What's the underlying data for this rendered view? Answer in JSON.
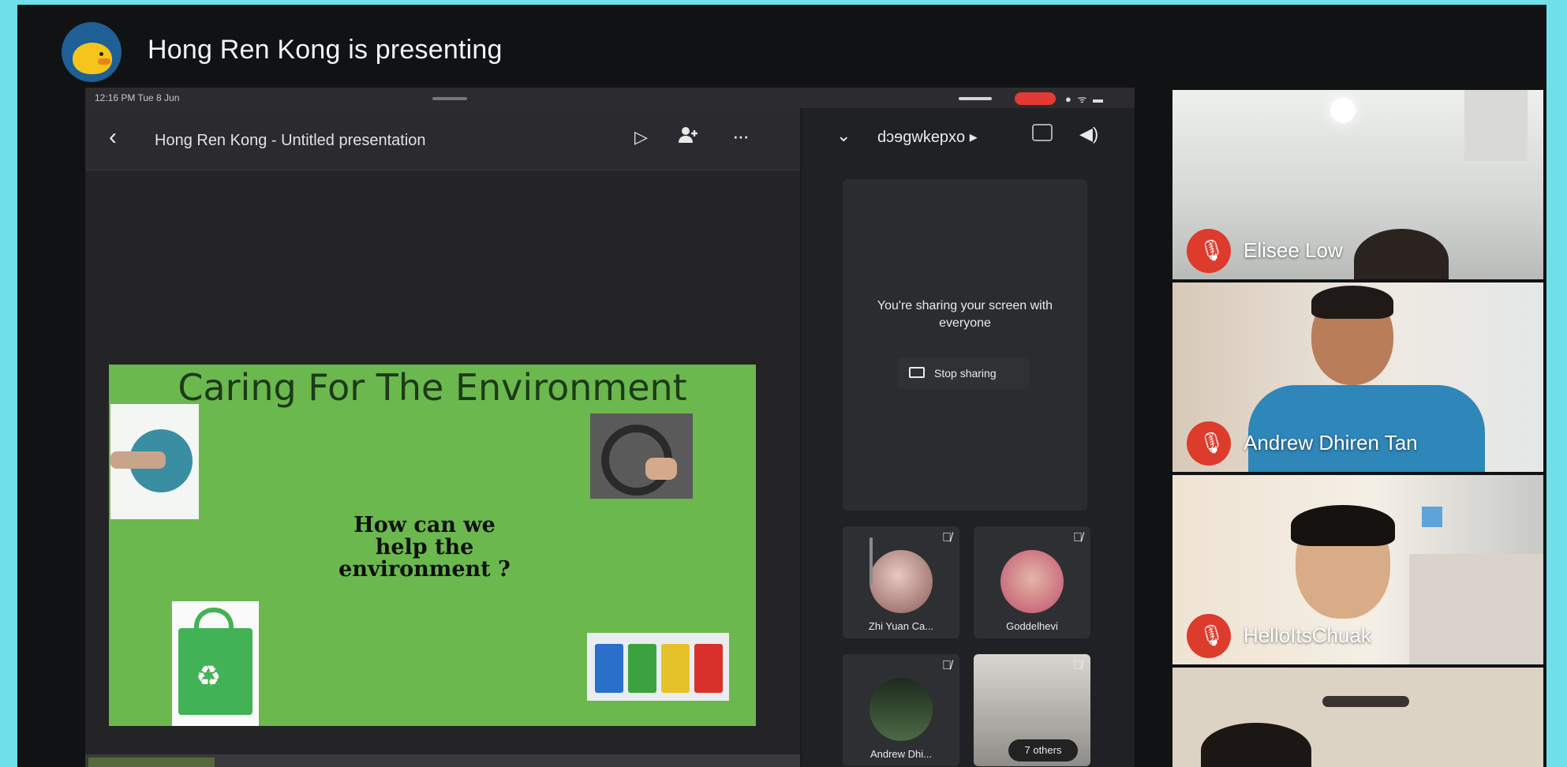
{
  "window": {
    "presenting_title": "Hong Ren Kong is presenting"
  },
  "ipad_status": {
    "time": "12:16 PM  Tue 8 Jun",
    "right_icons": "● ᯤ ▬"
  },
  "slides_app": {
    "back_icon": "‹",
    "doc_title": "Hong Ren Kong - Untitled presentation",
    "play_icon": "▷",
    "add_person_icon": "+",
    "more_icon": "···"
  },
  "slide": {
    "title": "Caring For The Environment",
    "question": "How can we help the environment ?",
    "section_headings": [
      "",
      "",
      "",
      ""
    ],
    "body_text": [
      "",
      "",
      "",
      ""
    ]
  },
  "meet_panel": {
    "collapse_icon": "⌄",
    "meeting_code": "dɔɘgwkepxo ▸",
    "speaker_icon": "◀)",
    "share_message": "You're sharing your screen with everyone",
    "stop_sharing_label": "Stop sharing",
    "tiles": [
      {
        "name": "Zhi Yuan Ca...",
        "mic_icon": "🎙̸"
      },
      {
        "name": "Goddelhevi",
        "mic_icon": "🎙̸"
      },
      {
        "name": "Andrew Dhi...",
        "mic_icon": "🎙̸"
      },
      {
        "name": "",
        "mic_icon": "🎙̸"
      }
    ],
    "others_label": "7 others"
  },
  "participants": [
    {
      "name": "Elisee Low",
      "muted": true
    },
    {
      "name": "Andrew Dhiren Tan",
      "muted": true
    },
    {
      "name": "HelloItsChuak",
      "muted": true
    },
    {
      "name": "",
      "muted": false
    }
  ],
  "colors": {
    "background": "#6fe0ea",
    "meet_dark": "#202124",
    "slide_green": "#6bb84f",
    "mute_red": "#dd3b2c"
  }
}
